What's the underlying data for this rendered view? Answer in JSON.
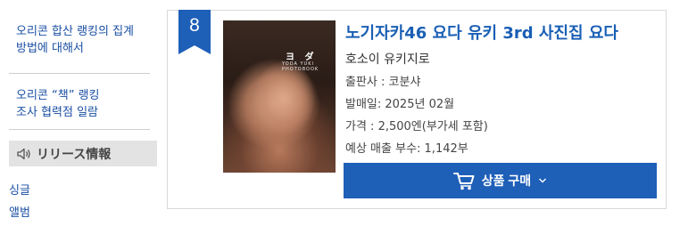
{
  "sidebar": {
    "link1_line1": "오리콘 합산 랭킹의 집계",
    "link1_line2": "방법에 대해서",
    "link2_line1": "오리콘 “책” 랭킹",
    "link2_line2": "조사 협력점 일람",
    "release_header": "リリース情報",
    "release_icon": "speaker-icon",
    "sub1": "싱글",
    "sub2": "앨범"
  },
  "item": {
    "rank": "8",
    "cover_title": "ヨ ダ",
    "cover_subtitle": "YODA YUKI PHOTOBOOK",
    "title": "노기자카46 요다 유키 3rd 사진집 요다",
    "author": "호소이 유키지로",
    "publisher": "출판사 : 코분샤",
    "release_date": "발매일: 2025년 02월",
    "price": "가격 : 2,500엔(부가세 포함)",
    "sales": "예상 매출 부수: 1,142부",
    "buy_label": "상품 구매",
    "buy_icon": "cart-icon",
    "accent_color": "#1e5fb8"
  }
}
